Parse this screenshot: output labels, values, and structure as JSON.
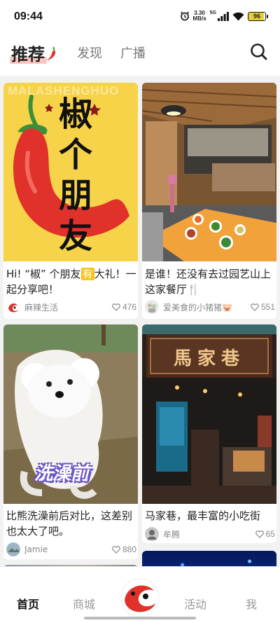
{
  "status_bar": {
    "time": "09:44",
    "speed_value": "3.30",
    "speed_unit": "MB/s",
    "network": "5G",
    "battery": "96"
  },
  "header": {
    "tabs": [
      "推荐",
      "发现",
      "广播"
    ],
    "active_tab": "推荐",
    "search_icon": "search-icon"
  },
  "colors": {
    "accent": "#e0322b",
    "highlight": "#f9c7c1",
    "inactive": "#777777"
  },
  "feed": {
    "cards": [
      {
        "image_words": [
          "椒",
          "个",
          "朋",
          "友"
        ],
        "image_watermark": "MALASHENGHUO",
        "title_parts": [
          "Hi! “椒” 个朋友",
          "有",
          "大礼！一起分享吧！"
        ],
        "author": "麻辣生活",
        "likes": "476"
      },
      {
        "title": "是谁！还没有去过园艺山上这家餐厅🍴",
        "author": "爱美食的小猪猪🐷",
        "likes": "551"
      },
      {
        "image_caption": "洗澡前",
        "title": "比熊洗澡前后对比，这差别也太大了吧。",
        "author": "Jamie",
        "likes": "880"
      },
      {
        "image_sign": "馬家巷",
        "title": "马家巷，最丰富的小吃街",
        "author": "牟腾",
        "likes": "65"
      }
    ]
  },
  "bottom_nav": {
    "items": [
      "首页",
      "商城",
      "活动",
      "我"
    ],
    "active": "首页"
  }
}
